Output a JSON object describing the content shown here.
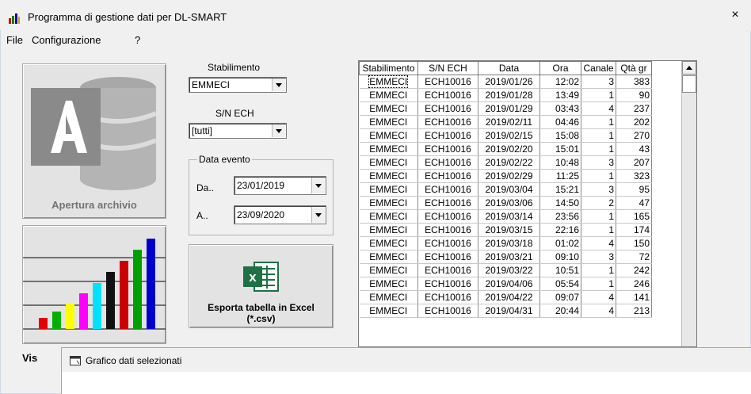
{
  "window": {
    "title": "Programma di gestione dati per DL-SMART",
    "close_label": "×"
  },
  "menu": [
    "File",
    "Configurazione",
    "?"
  ],
  "left_panel": {
    "archive_button_label": "Apertura archivio",
    "chart_button_label": "Vis"
  },
  "filters": {
    "stabilimento_label": "Stabilimento",
    "stabilimento_value": "EMMECI",
    "sn_label": "S/N ECH",
    "sn_value": "[tutti]",
    "group_title": "Data evento",
    "from_label": "Da..",
    "from_value": "23/01/2019",
    "to_label": "A..",
    "to_value": "23/09/2020"
  },
  "export_button": {
    "line1": "Esporta tabella in Excel",
    "line2": "(*.csv)",
    "icon": "excel-icon",
    "icon_text": "x"
  },
  "table": {
    "columns": [
      "Stabilimento",
      "S/N ECH",
      "Data",
      "Ora",
      "Canale",
      "Qtà gr"
    ],
    "rows": [
      [
        "EMMECI",
        "ECH10016",
        "2019/01/26",
        "12:02",
        "3",
        "383"
      ],
      [
        "EMMECI",
        "ECH10016",
        "2019/01/28",
        "13:49",
        "1",
        "90"
      ],
      [
        "EMMECI",
        "ECH10016",
        "2019/01/29",
        "03:43",
        "4",
        "237"
      ],
      [
        "EMMECI",
        "ECH10016",
        "2019/02/11",
        "04:46",
        "1",
        "202"
      ],
      [
        "EMMECI",
        "ECH10016",
        "2019/02/15",
        "15:08",
        "1",
        "270"
      ],
      [
        "EMMECI",
        "ECH10016",
        "2019/02/20",
        "15:01",
        "1",
        "43"
      ],
      [
        "EMMECI",
        "ECH10016",
        "2019/02/22",
        "10:48",
        "3",
        "207"
      ],
      [
        "EMMECI",
        "ECH10016",
        "2019/02/29",
        "11:25",
        "1",
        "323"
      ],
      [
        "EMMECI",
        "ECH10016",
        "2019/03/04",
        "15:21",
        "3",
        "95"
      ],
      [
        "EMMECI",
        "ECH10016",
        "2019/03/06",
        "14:50",
        "2",
        "47"
      ],
      [
        "EMMECI",
        "ECH10016",
        "2019/03/14",
        "23:56",
        "1",
        "165"
      ],
      [
        "EMMECI",
        "ECH10016",
        "2019/03/15",
        "22:16",
        "1",
        "174"
      ],
      [
        "EMMECI",
        "ECH10016",
        "2019/03/18",
        "01:02",
        "4",
        "150"
      ],
      [
        "EMMECI",
        "ECH10016",
        "2019/03/21",
        "09:10",
        "3",
        "72"
      ],
      [
        "EMMECI",
        "ECH10016",
        "2019/03/22",
        "10:51",
        "1",
        "242"
      ],
      [
        "EMMECI",
        "ECH10016",
        "2019/04/06",
        "05:54",
        "1",
        "246"
      ],
      [
        "EMMECI",
        "ECH10016",
        "2019/04/22",
        "09:07",
        "4",
        "141"
      ],
      [
        "EMMECI",
        "ECH10016",
        "2019/04/31",
        "20:44",
        "4",
        "213"
      ]
    ]
  },
  "child_window": {
    "title": "Grafico dati selezionati"
  },
  "colors": {
    "chart_bars": [
      "#e00000",
      "#00b000",
      "#ffff00",
      "#ff00ff",
      "#00e0ff",
      "#111111",
      "#cc0000",
      "#00a000",
      "#0000cc"
    ],
    "excel_green": "#1e7145"
  }
}
